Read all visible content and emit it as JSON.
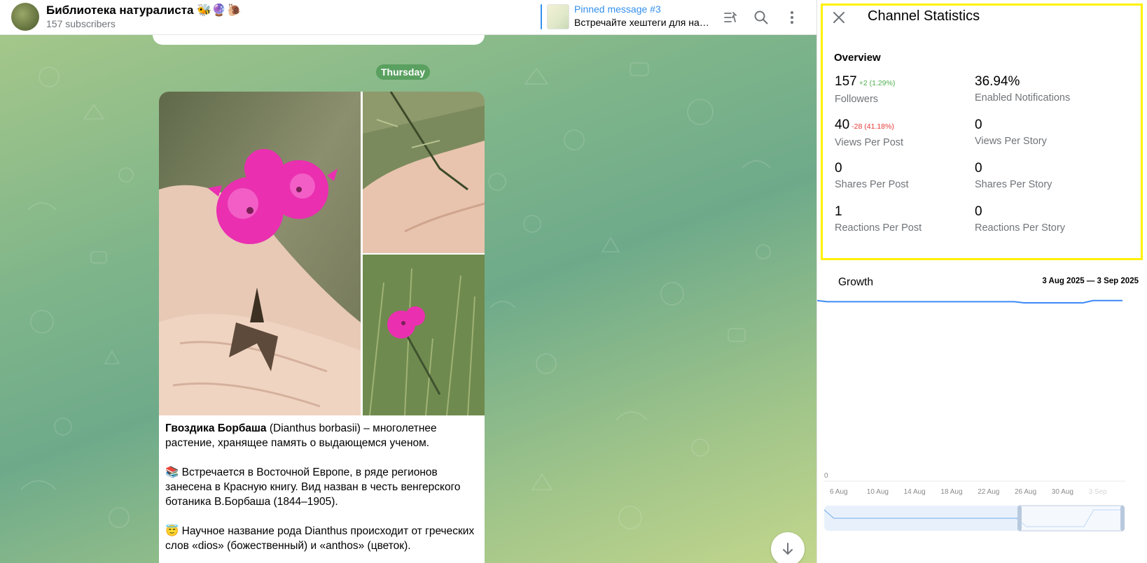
{
  "channel": {
    "title": "Библиотека натуралиста 🐝🔮🐌",
    "subscribers": "157 subscribers"
  },
  "pinned": {
    "title": "Pinned message #3",
    "text": "Встречайте хештеги для нав…"
  },
  "icons": {
    "pinned_list": "pinned-list-icon",
    "search": "search-icon",
    "more": "more-vertical-icon",
    "close": "close-icon",
    "scroll_down": "arrow-down-icon"
  },
  "chat": {
    "date_chip": "Thursday",
    "caption": {
      "title_bold": "Гвоздика Борбаша",
      "p1_rest": " (Dianthus borbasii) – многолетнее растение, хранящее память о выдающемся ученом.",
      "p2_emoji": "📚",
      "p2_text": " Встречается в Восточной Европе, в ряде регионов занесена в Красную книгу. Вид назван в честь венгерского ботаника В.Борбаша (1844–1905).",
      "p3_emoji": "😇",
      "p3_text": " Научное название рода Dianthus происходит от греческих слов «dios» (божественный) и «anthos» (цветок)."
    }
  },
  "stats": {
    "title": "Channel Statistics",
    "overview_title": "Overview",
    "items": [
      {
        "value": "157",
        "delta": "+2 (1.29%)",
        "delta_dir": "up",
        "label": "Followers"
      },
      {
        "value": "36.94%",
        "delta": "",
        "delta_dir": "",
        "label": "Enabled Notifications"
      },
      {
        "value": "40",
        "delta": "-28 (41.18%)",
        "delta_dir": "down",
        "label": "Views Per Post"
      },
      {
        "value": "0",
        "delta": "",
        "delta_dir": "",
        "label": "Views Per Story"
      },
      {
        "value": "0",
        "delta": "",
        "delta_dir": "",
        "label": "Shares Per Post"
      },
      {
        "value": "0",
        "delta": "",
        "delta_dir": "",
        "label": "Shares Per Story"
      },
      {
        "value": "1",
        "delta": "",
        "delta_dir": "",
        "label": "Reactions Per Post"
      },
      {
        "value": "0",
        "delta": "",
        "delta_dir": "",
        "label": "Reactions Per Story"
      }
    ],
    "growth_title": "Growth",
    "growth_range": "3 Aug 2025 — 3 Sep 2025",
    "growth_y_zero": "0"
  },
  "chart_data": {
    "type": "line",
    "title": "Growth",
    "x_tick_labels": [
      "6 Aug",
      "10 Aug",
      "14 Aug",
      "18 Aug",
      "22 Aug",
      "26 Aug",
      "30 Aug",
      "3 Sep"
    ],
    "x": [
      "3 Aug",
      "4 Aug",
      "5 Aug",
      "6 Aug",
      "7 Aug",
      "8 Aug",
      "9 Aug",
      "10 Aug",
      "11 Aug",
      "12 Aug",
      "13 Aug",
      "14 Aug",
      "15 Aug",
      "16 Aug",
      "17 Aug",
      "18 Aug",
      "19 Aug",
      "20 Aug",
      "21 Aug",
      "22 Aug",
      "23 Aug",
      "24 Aug",
      "25 Aug",
      "26 Aug",
      "27 Aug",
      "28 Aug",
      "29 Aug",
      "30 Aug",
      "31 Aug",
      "1 Sep",
      "2 Sep",
      "3 Sep"
    ],
    "series": [
      {
        "values": [
          157,
          156,
          156,
          156,
          156,
          156,
          156,
          156,
          156,
          156,
          156,
          156,
          156,
          156,
          156,
          156,
          156,
          156,
          156,
          156,
          156,
          155,
          155,
          155,
          155,
          155,
          155,
          155,
          157,
          157,
          157,
          157
        ],
        "color": "#3d8af7"
      }
    ],
    "y_min_label": "0",
    "grid": false,
    "navigator": true
  }
}
